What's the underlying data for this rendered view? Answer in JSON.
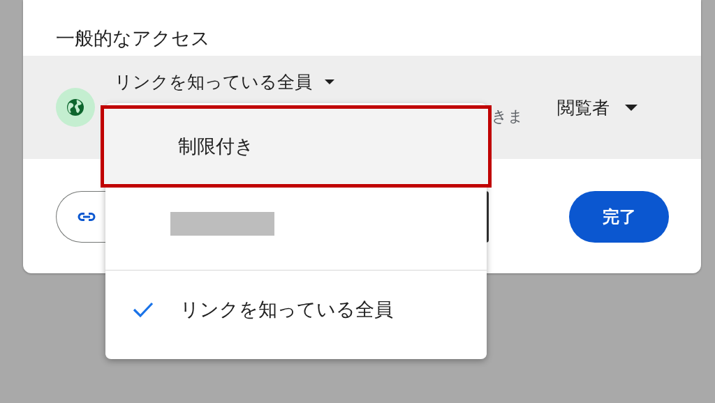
{
  "dialog": {
    "section_title": "一般的なアクセス",
    "access": {
      "title": "リンクを知っている全員",
      "description": "きま",
      "role": "閲覧者"
    },
    "done_button": "完了"
  },
  "access_menu": {
    "items": [
      {
        "kind": "option",
        "label": "制限付き",
        "selected": false,
        "highlighted": true
      },
      {
        "kind": "redacted",
        "selected": false,
        "highlighted": false
      },
      {
        "kind": "option",
        "label": "リンクを知っている全員",
        "selected": true,
        "highlighted": false
      }
    ]
  }
}
